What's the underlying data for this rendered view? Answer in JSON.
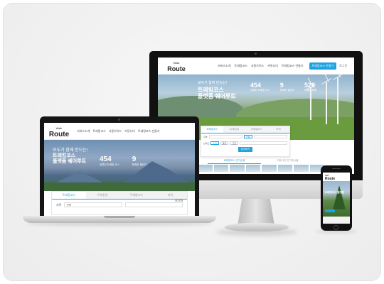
{
  "site": {
    "logo_mark": "Walk",
    "logo_text": "Route",
    "accent_color": "#1fa3e0"
  },
  "desktop": {
    "menu": [
      "서비스소개",
      "트레킹코스",
      "사용가이드",
      "커뮤니티",
      "트레킹코스 만들기"
    ],
    "cta": "트레킹코스 만들기",
    "login": "로그인",
    "hero_kicker": "모두가 함께 만드는!",
    "hero_title_1": "트레킹코스",
    "hero_title_2": "플랫폼 쉐어루트",
    "stats": [
      {
        "value": "454",
        "label": "등록된 트레킹 코스"
      },
      {
        "value": "9",
        "label": "등록된 챌린지"
      },
      {
        "value": "528",
        "label": "등록된 회원"
      }
    ],
    "tabs": [
      "트레킹코스",
      "트레킹길",
      "주제별코스",
      "지역"
    ],
    "filters": [
      "지역",
      "전체",
      "난이도",
      "초급",
      "중급",
      "고급"
    ],
    "search_label": "검색하기",
    "section_tabs": [
      "트레킹코스 인기순위",
      "커뮤니티 인기게시물"
    ]
  },
  "laptop": {
    "menu": [
      "서비스소개",
      "트레킹코스",
      "사용가이드",
      "커뮤니티",
      "트레킹코스 만들기"
    ],
    "hero_kicker": "모두가 함께 만드는!",
    "hero_title_1": "트레킹코스",
    "hero_title_2": "플랫폼 쉐어루트",
    "stats": [
      {
        "value": "454",
        "label": "등록된 트레킹 코스"
      },
      {
        "value": "9",
        "label": "등록된 챌린지"
      }
    ],
    "tabs": [
      "트레킹코스",
      "트레킹길",
      "주제별코스",
      "지역"
    ],
    "region_label": "지역",
    "region_value": "선택",
    "reset_label": "초기화"
  },
  "phone": {
    "hero_title": "트레킹코스 플랫폼"
  }
}
